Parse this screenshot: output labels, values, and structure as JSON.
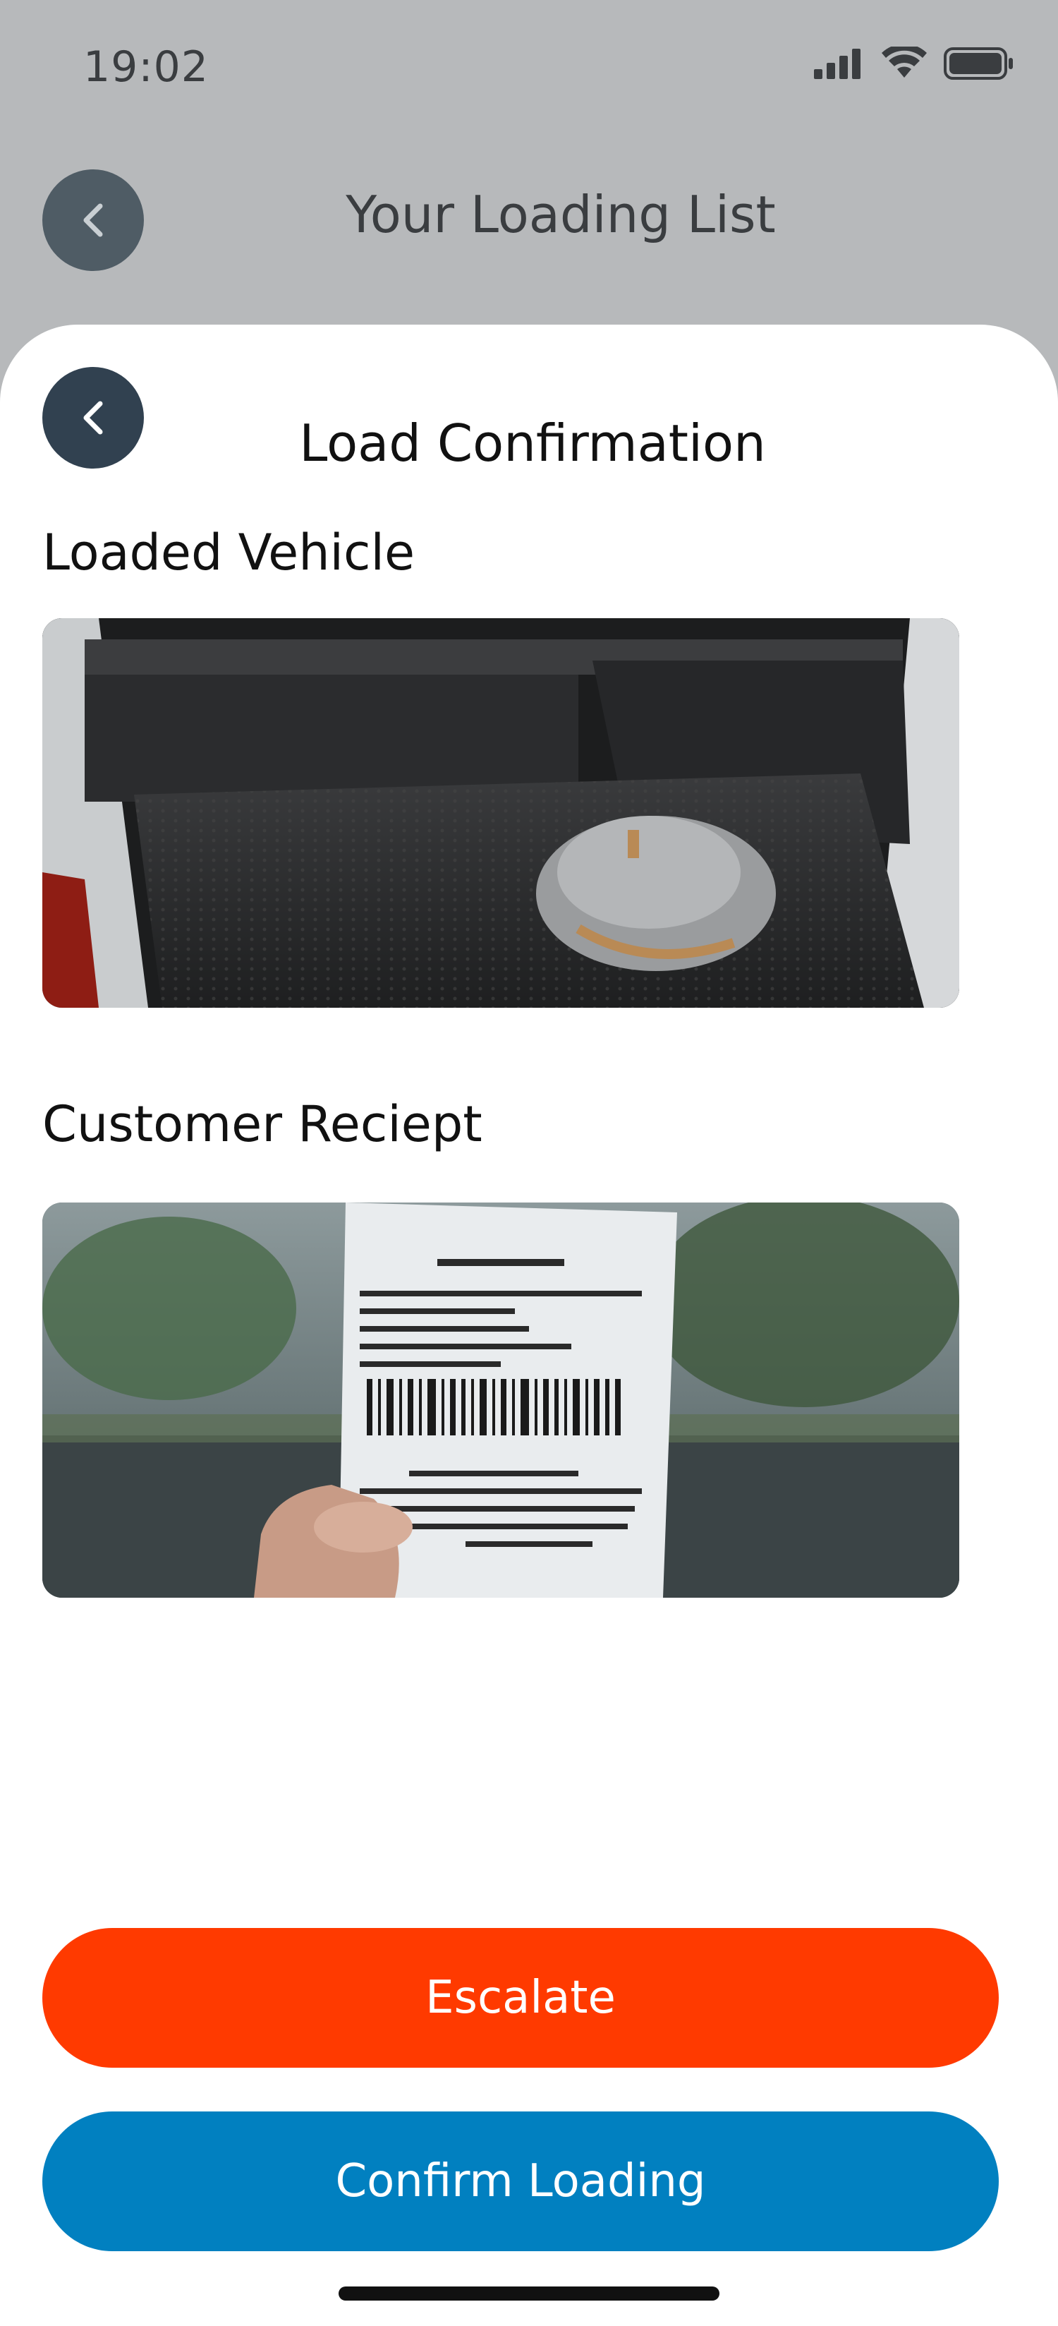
{
  "status_bar": {
    "time": "19:02"
  },
  "header": {
    "title": "Your Loading List"
  },
  "sheet": {
    "title": "Load Confirmation",
    "sections": [
      {
        "label": "Loaded Vehicle"
      },
      {
        "label": "Customer Reciept"
      }
    ]
  },
  "actions": {
    "escalate_label": "Escalate",
    "confirm_label": "Confirm Loading"
  },
  "colors": {
    "escalate": "#ff3a00",
    "confirm": "#0180c0",
    "back_button": "#314150"
  },
  "icons": [
    "back-arrow-icon",
    "signal-icon",
    "wifi-icon",
    "battery-icon"
  ]
}
